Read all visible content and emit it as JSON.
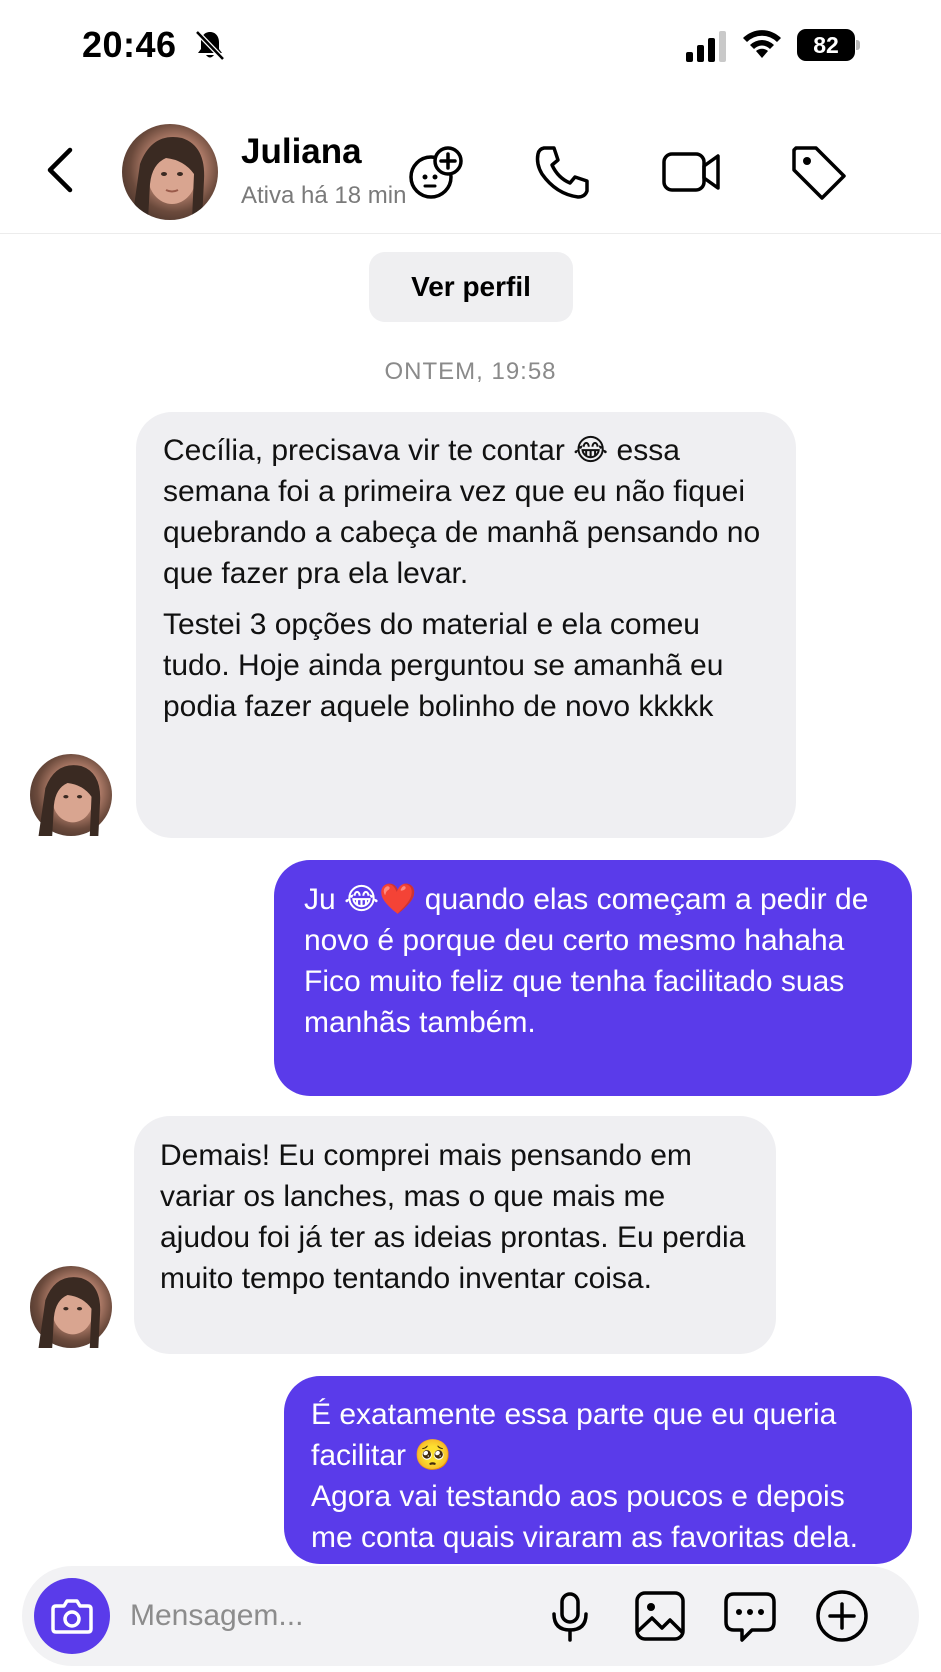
{
  "status_bar": {
    "time": "20:46",
    "battery": "82",
    "icons": [
      "bell-slash-icon",
      "cellular-signal-icon",
      "wifi-icon",
      "battery-icon"
    ]
  },
  "header": {
    "name": "Juliana",
    "status": "Ativa há 18 min",
    "icons": [
      "back-chevron-icon",
      "sticker-add-icon",
      "phone-icon",
      "video-camera-icon",
      "tag-icon"
    ]
  },
  "chat": {
    "view_profile": "Ver perfil",
    "timestamp": "ONTEM, 19:58",
    "messages": [
      {
        "from": "Juliana",
        "paragraphs": [
          "Cecília, precisava vir te contar 😂 essa semana foi a primeira vez que eu não fiquei quebrando a cabeça de manhã pensando no que fazer pra ela levar.",
          "Testei 3 opções do material e ela comeu tudo. Hoje ainda perguntou se amanhã eu podia fazer aquele bolinho de novo kkkkk"
        ]
      },
      {
        "from": "me",
        "lines": [
          "Ju 😂❤️ quando elas começam a pedir de novo é porque deu certo mesmo hahaha",
          "Fico muito feliz que tenha facilitado suas manhãs também."
        ]
      },
      {
        "from": "Juliana",
        "paragraphs": [
          "Demais! Eu comprei mais pensando em variar os lanches, mas o que mais me ajudou foi já ter as ideias prontas. Eu perdia muito tempo tentando inventar coisa."
        ]
      },
      {
        "from": "me",
        "lines": [
          "É exatamente essa parte que eu queria facilitar 🥺",
          "Agora vai testando aos poucos e depois me conta quais viraram as favoritas dela."
        ]
      }
    ]
  },
  "composer": {
    "placeholder": "Mensagem...",
    "icons": [
      "camera-icon",
      "microphone-icon",
      "image-icon",
      "chat-bubble-icon",
      "plus-circle-icon"
    ]
  },
  "colors": {
    "accent": "#5a3bea",
    "incoming_bubble": "#efeff2",
    "secondary_text": "#7a7a7a"
  }
}
